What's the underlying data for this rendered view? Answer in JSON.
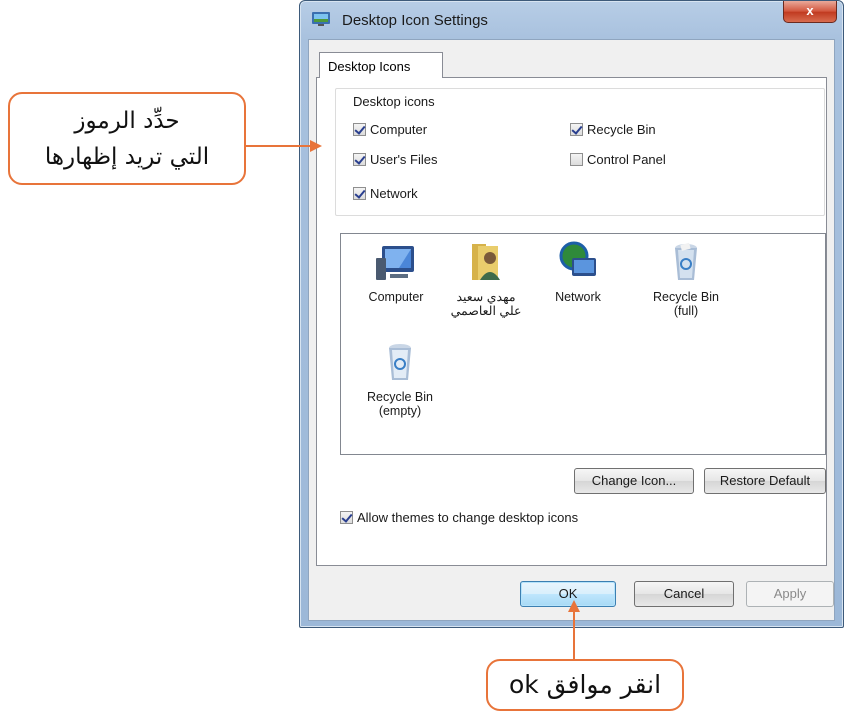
{
  "window": {
    "title": "Desktop Icon Settings",
    "close_glyph": "x"
  },
  "tabs": [
    {
      "label": "Desktop Icons",
      "active": true
    }
  ],
  "group": {
    "label": "Desktop icons",
    "checkboxes": [
      {
        "label": "Computer",
        "checked": true
      },
      {
        "label": "User's Files",
        "checked": true
      },
      {
        "label": "Network",
        "checked": true
      },
      {
        "label": "Recycle Bin",
        "checked": true
      },
      {
        "label": "Control Panel",
        "checked": false
      }
    ]
  },
  "icons": [
    {
      "label": "Computer",
      "icon": "computer-icon"
    },
    {
      "label": "مهدي سعيد",
      "label2": "علي العاصمي",
      "icon": "user-folder-icon"
    },
    {
      "label": "Network",
      "icon": "network-icon"
    },
    {
      "label": "Recycle Bin",
      "label2": "(full)",
      "icon": "recycle-bin-full-icon"
    },
    {
      "label": "Recycle Bin",
      "label2": "(empty)",
      "icon": "recycle-bin-empty-icon"
    }
  ],
  "buttons": {
    "change_icon": "Change Icon...",
    "restore_default": "Restore Default",
    "ok": "OK",
    "cancel": "Cancel",
    "apply": "Apply"
  },
  "allow_themes": {
    "label": "Allow themes to change desktop icons",
    "checked": true
  },
  "callouts": {
    "top_line1": "حدِّد الرموز",
    "top_line2": "التي تريد إظهارها",
    "bottom": "انقر موافق ok"
  },
  "colors": {
    "accent": "#e8743a"
  }
}
